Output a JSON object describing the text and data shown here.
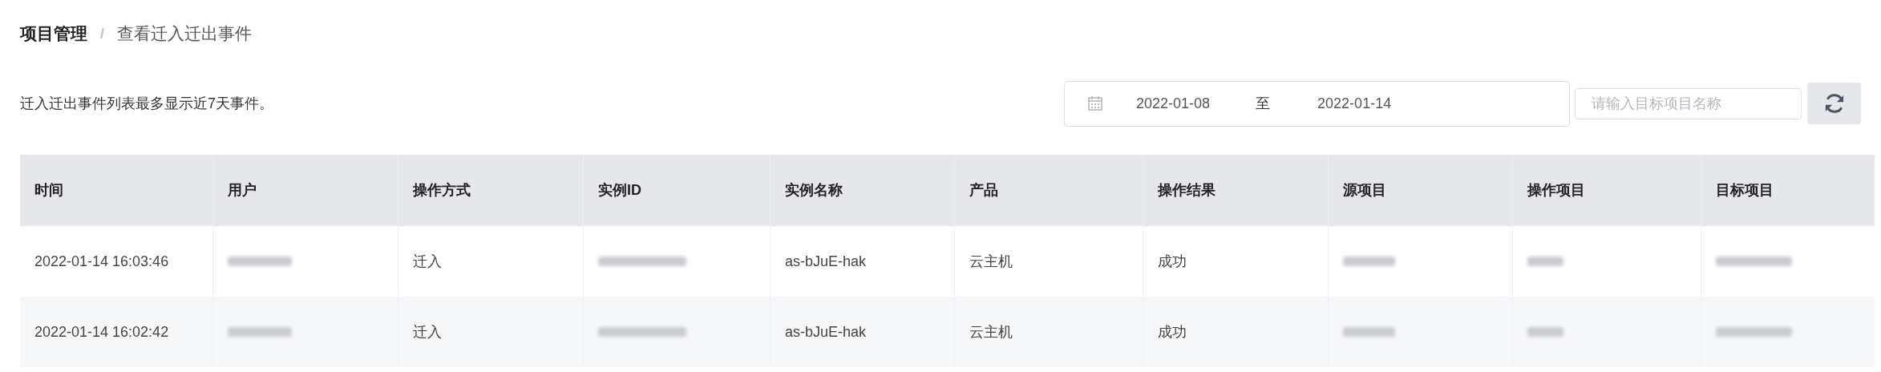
{
  "breadcrumb": [
    {
      "label": "项目管理",
      "current": false
    },
    {
      "label": "/",
      "kind": "separator"
    },
    {
      "label": "查看迁入迁出事件",
      "current": true
    }
  ],
  "notice": "迁入迁出事件列表最多显示近7天事件。",
  "date_range": {
    "start": "2022-01-08",
    "separator": "至",
    "end": "2022-01-14"
  },
  "search": {
    "placeholder": "请输入目标项目名称"
  },
  "table": {
    "columns": [
      "时间",
      "用户",
      "操作方式",
      "实例ID",
      "实例名称",
      "产品",
      "操作结果",
      "源项目",
      "操作项目",
      "目标项目"
    ],
    "rows": [
      {
        "cells": [
          {
            "kind": "text",
            "text": "2022-01-14 16:03:46"
          },
          {
            "kind": "redacted"
          },
          {
            "kind": "text",
            "text": "迁入"
          },
          {
            "kind": "redacted"
          },
          {
            "kind": "text",
            "text": "as-bJuE-hak"
          },
          {
            "kind": "text",
            "text": "云主机"
          },
          {
            "kind": "text",
            "text": "成功"
          },
          {
            "kind": "redacted"
          },
          {
            "kind": "redacted"
          },
          {
            "kind": "redacted"
          }
        ]
      },
      {
        "cells": [
          {
            "kind": "text",
            "text": "2022-01-14 16:02:42"
          },
          {
            "kind": "redacted"
          },
          {
            "kind": "text",
            "text": "迁入"
          },
          {
            "kind": "redacted"
          },
          {
            "kind": "text",
            "text": "as-bJuE-hak"
          },
          {
            "kind": "text",
            "text": "云主机"
          },
          {
            "kind": "text",
            "text": "成功"
          },
          {
            "kind": "redacted"
          },
          {
            "kind": "redacted"
          },
          {
            "kind": "redacted"
          }
        ]
      }
    ]
  }
}
